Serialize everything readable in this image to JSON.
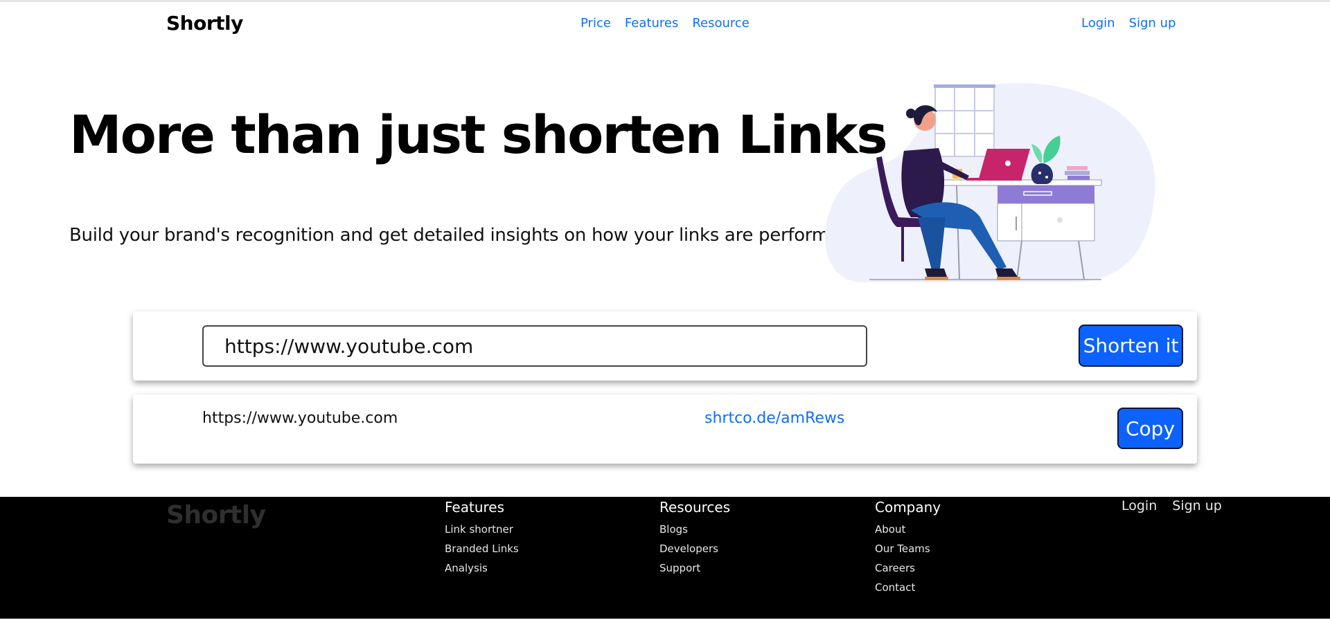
{
  "nav": {
    "brand": "Shortly",
    "links": [
      {
        "label": "Price"
      },
      {
        "label": "Features"
      },
      {
        "label": "Resource"
      }
    ],
    "login": "Login",
    "signup": "Sign up"
  },
  "hero": {
    "title": "More than just shorten Links",
    "subtitle": "Build your brand's recognition and get detailed insights on how your links are performing",
    "illustration_icon": "woman-working-at-desk-illustration"
  },
  "shortener": {
    "input_value": "https://www.youtube.com",
    "button_label": "Shorten it"
  },
  "result": {
    "original_url": "https://www.youtube.com",
    "short_url": "shrtco.de/amRews",
    "copy_label": "Copy"
  },
  "footer": {
    "brand": "Shortly",
    "features": {
      "title": "Features",
      "links": [
        "Link shortner",
        "Branded Links",
        "Analysis"
      ]
    },
    "resources": {
      "title": "Resources",
      "links": [
        "Blogs",
        "Developers",
        "Support"
      ]
    },
    "company": {
      "title": "Company",
      "links": [
        "About",
        "Our Teams",
        "Careers",
        "Contact"
      ]
    },
    "login": "Login",
    "signup": "Sign up"
  },
  "colors": {
    "accent": "#0d6efd",
    "button": "#0d62fd",
    "footer_bg": "#000000"
  }
}
